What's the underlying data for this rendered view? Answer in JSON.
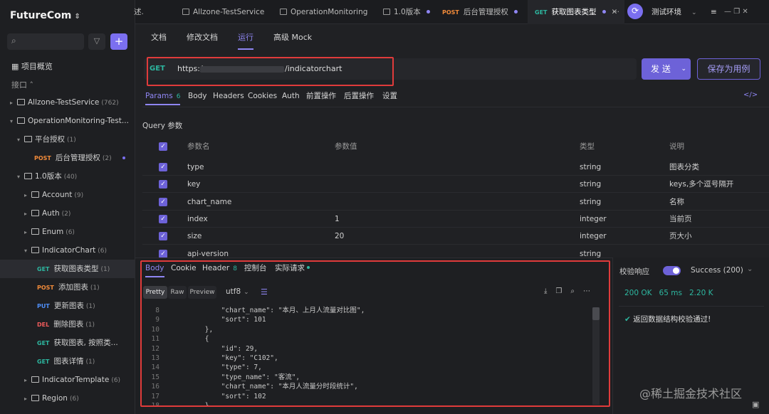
{
  "brand": "FutureCom",
  "sidebar": {
    "overview": "项目概览",
    "section": "接口",
    "tree": [
      {
        "label": "Allzone-TestService",
        "count": "(762)",
        "type": "folder",
        "depth": 1,
        "expanded": false
      },
      {
        "label": "OperationMonitoring-Test...",
        "count": "",
        "type": "folder",
        "depth": 1,
        "expanded": true
      },
      {
        "label": "平台授权",
        "count": "(1)",
        "type": "folder",
        "depth": 2,
        "expanded": true
      },
      {
        "label": "后台管理授权",
        "count": "(2)",
        "type": "api",
        "method": "POST",
        "depth": 3
      },
      {
        "label": "1.0版本",
        "count": "(40)",
        "type": "folder",
        "depth": 2,
        "expanded": true
      },
      {
        "label": "Account",
        "count": "(9)",
        "type": "folder",
        "depth": 3,
        "expanded": false
      },
      {
        "label": "Auth",
        "count": "(2)",
        "type": "folder",
        "depth": 3,
        "expanded": false
      },
      {
        "label": "Enum",
        "count": "(6)",
        "type": "folder",
        "depth": 3,
        "expanded": false
      },
      {
        "label": "IndicatorChart",
        "count": "(6)",
        "type": "folder",
        "depth": 3,
        "expanded": true
      },
      {
        "label": "获取图表类型",
        "count": "(1)",
        "type": "api",
        "method": "GET",
        "depth": 4,
        "selected": true
      },
      {
        "label": "添加图表",
        "count": "(1)",
        "type": "api",
        "method": "POST",
        "depth": 4
      },
      {
        "label": "更新图表",
        "count": "(1)",
        "type": "api",
        "method": "PUT",
        "depth": 4
      },
      {
        "label": "删除图表",
        "count": "(1)",
        "type": "api",
        "method": "DEL",
        "depth": 4
      },
      {
        "label": "获取图表, 按照类...",
        "count": "",
        "type": "api",
        "method": "GET",
        "depth": 4
      },
      {
        "label": "图表详情",
        "count": "(1)",
        "type": "api",
        "method": "GET",
        "depth": 4
      },
      {
        "label": "IndicatorTemplate",
        "count": "(6)",
        "type": "folder",
        "depth": 3,
        "expanded": false
      },
      {
        "label": "Region",
        "count": "(6)",
        "type": "folder",
        "depth": 3,
        "expanded": false
      }
    ]
  },
  "tabs": [
    {
      "label": "述.",
      "method": "",
      "icon": false
    },
    {
      "label": "Allzone-TestService",
      "method": "",
      "icon": true
    },
    {
      "label": "OperationMonitoring",
      "method": "",
      "icon": true
    },
    {
      "label": "1.0版本",
      "method": "",
      "icon": true,
      "dot": true
    },
    {
      "label": "后台管理授权",
      "method": "POST",
      "icon": false
    },
    {
      "label": "获取图表类型",
      "method": "GET",
      "icon": false,
      "active": true
    }
  ],
  "tabs_more": "···",
  "environment": "测试环境",
  "subtabs": [
    "文档",
    "修改文档",
    "运行",
    "高级 Mock"
  ],
  "request": {
    "method": "GET",
    "url_prefix": "https:/",
    "url_suffix": "/indicatorchart",
    "send_label": "发 送",
    "save_label": "保存为用例"
  },
  "param_tabs": [
    {
      "label": "Params",
      "badge": "6",
      "active": true
    },
    {
      "label": "Body"
    },
    {
      "label": "Headers"
    },
    {
      "label": "Cookies"
    },
    {
      "label": "Auth"
    },
    {
      "label": "前置操作"
    },
    {
      "label": "后置操作"
    },
    {
      "label": "设置"
    }
  ],
  "query_title": "Query 参数",
  "params_table": {
    "headers": [
      "参数名",
      "参数值",
      "类型",
      "说明"
    ],
    "rows": [
      [
        "type",
        "",
        "string",
        "图表分类"
      ],
      [
        "key",
        "",
        "string",
        "keys,多个逗号隔开"
      ],
      [
        "chart_name",
        "",
        "string",
        "名称"
      ],
      [
        "index",
        "1",
        "integer",
        "当前页"
      ],
      [
        "size",
        "20",
        "integer",
        "页大小"
      ],
      [
        "api-version",
        "",
        "string",
        ""
      ]
    ]
  },
  "response": {
    "tabs": [
      {
        "label": "Body",
        "active": true
      },
      {
        "label": "Cookie"
      },
      {
        "label": "Header",
        "badge": "8"
      },
      {
        "label": "控制台"
      },
      {
        "label": "实际请求"
      }
    ],
    "format_buttons": [
      "Pretty",
      "Raw",
      "Preview"
    ],
    "encoding": "utf8",
    "code_lines": [
      [
        "8",
        "            \"chart_name\": \"本月、上月人流量对比图\","
      ],
      [
        "9",
        "            \"sort\": 101"
      ],
      [
        "10",
        "        },"
      ],
      [
        "11",
        "        {"
      ],
      [
        "12",
        "            \"id\": 29,"
      ],
      [
        "13",
        "            \"key\": \"C102\","
      ],
      [
        "14",
        "            \"type\": 7,"
      ],
      [
        "15",
        "            \"type_name\": \"客流\","
      ],
      [
        "16",
        "            \"chart_name\": \"本月人流量分时段统计\","
      ],
      [
        "17",
        "            \"sort\": 102"
      ],
      [
        "18",
        "        }"
      ]
    ]
  },
  "validation": {
    "label": "校验响应",
    "status_select": "Success (200)",
    "status": "200 OK",
    "time": "65 ms",
    "size": "2.20 K",
    "message": "返回数据结构校验通过!"
  },
  "watermark": "@稀土掘金技术社区",
  "colors": {
    "accent": "#7b6ff0",
    "get": "#2db7a0",
    "post": "#f08a3a",
    "put": "#4f8ef7",
    "del": "#ef5b5b",
    "highlight_box": "#e03b3b"
  }
}
